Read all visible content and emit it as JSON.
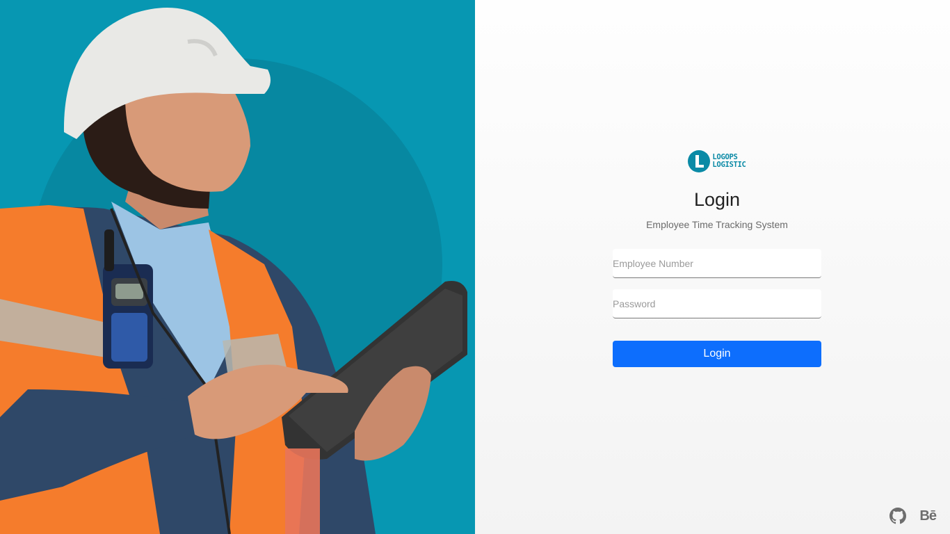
{
  "brand": {
    "line1": "LOGOPS",
    "line2": "LOGISTIC",
    "color": "#0a8aa6"
  },
  "login": {
    "title": "Login",
    "subtitle": "Employee Time Tracking System",
    "employee_placeholder": "Employee Number",
    "password_placeholder": "Password",
    "button_label": "Login",
    "button_color": "#0d6efd"
  },
  "footer": {
    "icons": [
      "github-icon",
      "behance-icon"
    ],
    "behance_label": "Bē"
  },
  "hero": {
    "background_color": "#0797b2",
    "image": "worker-with-hard-hat-and-tablet"
  }
}
